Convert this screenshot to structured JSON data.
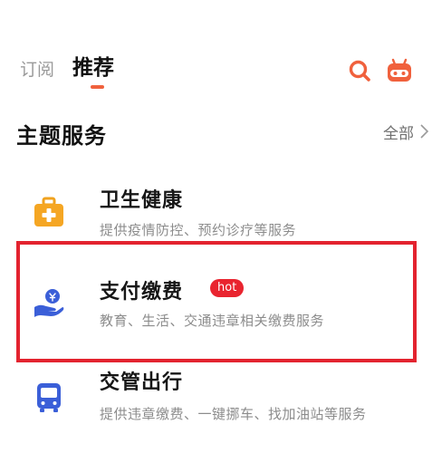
{
  "tabs": [
    {
      "label": "订阅",
      "active": false
    },
    {
      "label": "推荐",
      "active": true
    }
  ],
  "colors": {
    "accent": "#f0613d",
    "highlight": "#e3232f",
    "hot": "#e9242f",
    "icon_blue": "#3b5fd8",
    "icon_orange": "#f0a21e"
  },
  "icons": {
    "search": "search-icon",
    "assistant": "robot-icon"
  },
  "section": {
    "title": "主题服务",
    "view_all": "全部"
  },
  "services": [
    {
      "title": "卫生健康",
      "description": "提供疫情防控、预约诊疗等服务",
      "icon": "medical-kit-icon"
    },
    {
      "title": "支付缴费",
      "description": "教育、生活、交通违章相关缴费服务",
      "icon": "payment-hand-icon",
      "badge": "hot"
    },
    {
      "title": "交管出行",
      "description": "提供违章缴费、一键挪车、找加油站等服务",
      "icon": "bus-icon"
    }
  ]
}
